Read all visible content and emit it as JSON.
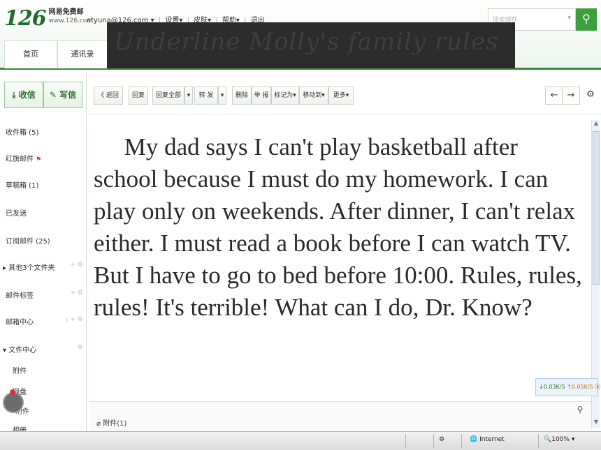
{
  "header": {
    "logo_number": "126",
    "logo_title": "网易免费邮",
    "logo_url": "www.126.com",
    "user_account": "atyuna@126.com ▾",
    "links": [
      "设置▾",
      "皮肤▾",
      "帮助▾",
      "退出"
    ],
    "search_placeholder": "搜索邮件",
    "tabs": [
      {
        "label": "首页"
      },
      {
        "label": "通讯录"
      }
    ]
  },
  "title_banner": "Underline Molly's family rules",
  "sidebar": {
    "inbox_label": "收信",
    "compose_label": "写信",
    "folders": [
      {
        "label": "收件箱 (5)"
      },
      {
        "label": "红旗邮件"
      },
      {
        "label": "草稿箱 (1)"
      },
      {
        "label": "已发送"
      },
      {
        "label": "订阅邮件 (25)"
      },
      {
        "label": "▸ 其他3个文件夹"
      },
      {
        "label": "邮件标签"
      },
      {
        "label": "邮箱中心"
      },
      {
        "label": "▾ 文件中心"
      },
      {
        "label": "附件"
      },
      {
        "label": "网盘"
      },
      {
        "label": "附件"
      },
      {
        "label": "相册"
      }
    ]
  },
  "toolbar": {
    "back": "《 返回",
    "reply": "回复",
    "reply_all": "回复全部",
    "forward": "转 发",
    "delete": "删除",
    "report": "举 报",
    "mark_as": "标记为▾",
    "move_to": "移动到▾",
    "more": "更多▾",
    "prev_arrow": "←",
    "next_arrow": "→",
    "settings_icon": "⚙"
  },
  "message": {
    "body": "My dad says I can't play basketball after school because I must do my homework. I can play only on weekends. After dinner, I can't relax either. I must read a book before I can watch TV. But I have to go to bed before 10:00. Rules, rules, rules! It's terrible! What can I do, Dr. Know?"
  },
  "speed": {
    "down": "↓0.03K/S",
    "up": "↑0.05K/S"
  },
  "attachment_label": "附件(1)",
  "statusbar": {
    "zone": "Internet",
    "zoom": "100%"
  }
}
